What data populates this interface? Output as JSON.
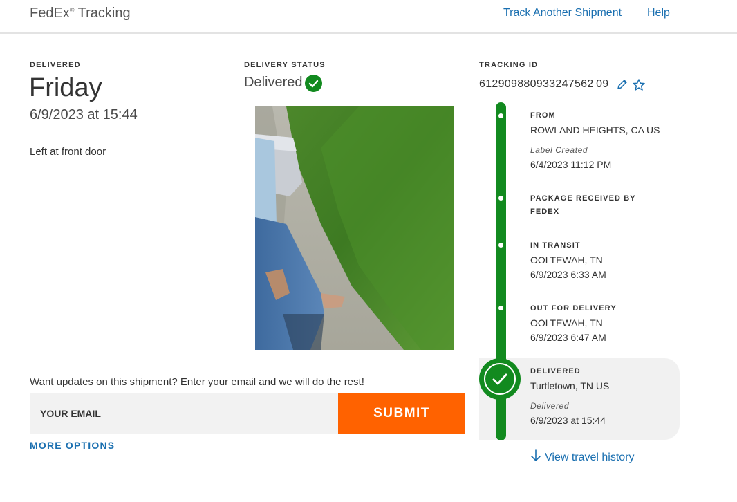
{
  "header": {
    "brand": "FedEx",
    "brand_reg": "®",
    "brand_suffix": "Tracking",
    "nav": {
      "track_another": "Track Another Shipment",
      "help": "Help"
    }
  },
  "delivery": {
    "label": "DELIVERED",
    "day": "Friday",
    "datetime": "6/9/2023 at 15:44",
    "note": "Left at front door"
  },
  "status": {
    "label": "DELIVERY STATUS",
    "value": "Delivered",
    "icon": "check-circle-icon"
  },
  "tracking": {
    "label": "TRACKING ID",
    "number": "612909880933247562 09",
    "icons": [
      "pencil-icon",
      "star-outline-icon"
    ]
  },
  "timeline": {
    "events": [
      {
        "title": "FROM",
        "location": "ROWLAND HEIGHTS, CA US",
        "status": "Label Created",
        "time": "6/4/2023 11:12 PM"
      },
      {
        "title": "PACKAGE RECEIVED BY",
        "title2": "FEDEX"
      },
      {
        "title": "IN TRANSIT",
        "location": "OOLTEWAH, TN",
        "time": "6/9/2023 6:33 AM"
      },
      {
        "title": "OUT FOR DELIVERY",
        "location": "OOLTEWAH, TN",
        "time": "6/9/2023 6:47 AM"
      },
      {
        "title": "DELIVERED",
        "location": "Turtletown, TN US",
        "status": "Delivered",
        "time": "6/9/2023 at 15:44"
      }
    ],
    "view_history": "View travel history"
  },
  "updates": {
    "prompt": "Want updates on this shipment? Enter your email and we will do the rest!",
    "email_placeholder": "YOUR EMAIL",
    "submit_label": "SUBMIT",
    "more_options": "MORE OPTIONS"
  },
  "colors": {
    "accent_blue": "#1a6fb0",
    "status_green": "#128a1f",
    "submit_orange": "#ff6200"
  }
}
